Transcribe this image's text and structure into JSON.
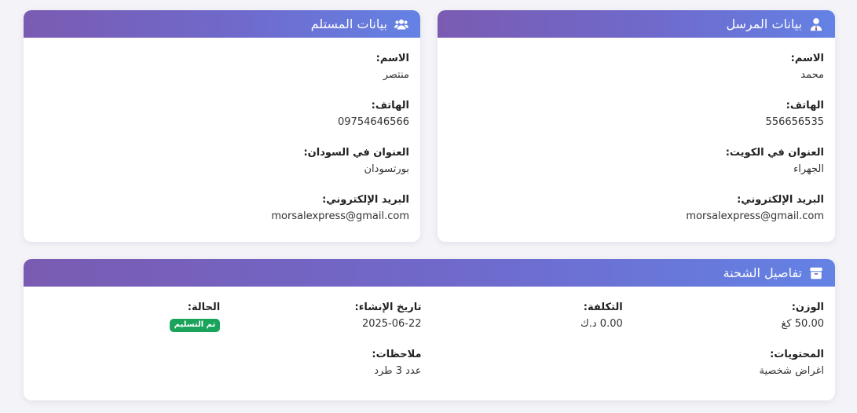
{
  "sender": {
    "title": "بيانات المرسل",
    "icon": "user-tie-icon",
    "fields": [
      {
        "label": "الاسم:",
        "value": "محمد"
      },
      {
        "label": "الهاتف:",
        "value": "556656535"
      },
      {
        "label": "العنوان في الكويت:",
        "value": "الجهراء"
      },
      {
        "label": "البريد الإلكتروني:",
        "value": "morsalexpress@gmail.com"
      }
    ]
  },
  "receiver": {
    "title": "بيانات المستلم",
    "icon": "users-icon",
    "fields": [
      {
        "label": "الاسم:",
        "value": "منتصر"
      },
      {
        "label": "الهاتف:",
        "value": "09754646566"
      },
      {
        "label": "العنوان في السودان:",
        "value": "بورتسودان"
      },
      {
        "label": "البريد الإلكتروني:",
        "value": "morsalexpress@gmail.com"
      }
    ]
  },
  "shipment": {
    "title": "تفاصيل الشحنة",
    "icon": "box-icon",
    "weight": {
      "label": "الوزن:",
      "value": "50.00 كغ"
    },
    "cost": {
      "label": "التكلفة:",
      "value": "0.00 د.ك"
    },
    "created": {
      "label": "تاريخ الإنشاء:",
      "value": "2025-06-22"
    },
    "status": {
      "label": "الحالة:",
      "value": "تم التسليم",
      "color": "#1aa35a"
    },
    "contents": {
      "label": "المحتويات:",
      "value": "اغراض شخصية"
    },
    "notes": {
      "label": "ملاحظات:",
      "value": "عدد 3 طرد"
    }
  },
  "colors": {
    "header_gradient_start": "#6382e4",
    "header_gradient_end": "#7a5bb2",
    "page_background": "#f3f3f8"
  }
}
